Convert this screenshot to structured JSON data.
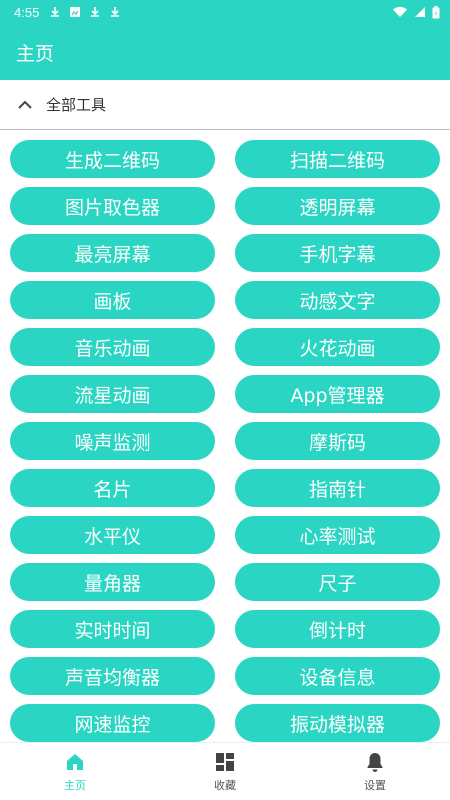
{
  "status_bar": {
    "time": "4:55",
    "colors": {
      "accent": "#2ad6c3"
    }
  },
  "app_bar": {
    "title": "主页"
  },
  "section": {
    "label": "全部工具",
    "icon": "chevron-up-icon"
  },
  "tools": [
    "生成二维码",
    "扫描二维码",
    "图片取色器",
    "透明屏幕",
    "最亮屏幕",
    "手机字幕",
    "画板",
    "动感文字",
    "音乐动画",
    "火花动画",
    "流星动画",
    "App管理器",
    "噪声监测",
    "摩斯码",
    "名片",
    "指南针",
    "水平仪",
    "心率测试",
    "量角器",
    "尺子",
    "实时时间",
    "倒计时",
    "声音均衡器",
    "设备信息",
    "网速监控",
    "振动模拟器"
  ],
  "bottom_nav": {
    "items": [
      {
        "label": "主页",
        "icon": "home-icon",
        "active": true
      },
      {
        "label": "收藏",
        "icon": "grid-icon",
        "active": false
      },
      {
        "label": "设置",
        "icon": "bell-icon",
        "active": false
      }
    ]
  }
}
